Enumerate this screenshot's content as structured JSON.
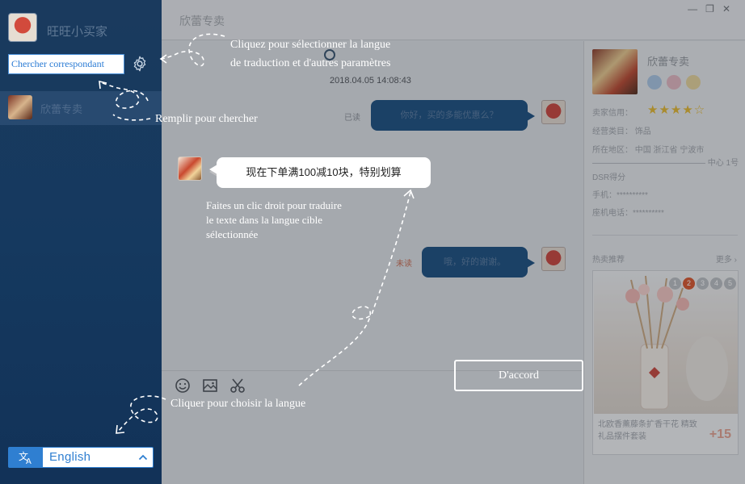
{
  "sidebar": {
    "username": "旺旺小买家",
    "search": {
      "value": "Chercher correspondant"
    },
    "contacts": [
      {
        "name": "欣蕾专卖"
      }
    ],
    "language": {
      "icon": "translate-icon",
      "label": "English"
    }
  },
  "chat": {
    "title": "欣蕾专卖",
    "timestamp": "2018.04.05 14:08:43",
    "messages": [
      {
        "side": "right",
        "text": "你好，买的多能优惠么？",
        "status": "已读"
      },
      {
        "side": "left",
        "text": "现在下单满100减10块，特别划算"
      },
      {
        "side": "right",
        "text": "哦，好的谢谢。",
        "status": "未读"
      }
    ],
    "toolbar": {
      "icons": [
        "emoji-icon",
        "image-icon",
        "scissors-icon"
      ]
    },
    "ok_button": "D'accord"
  },
  "info_panel": {
    "shop_name": "欣蕾专卖",
    "rows": {
      "rating": "卖家信用：",
      "brand": "经营类目：  饰品",
      "location": "所在地区：  中国 浙江省 宁波市",
      "location_2": "—————————————— 中心 1号",
      "dsr": "DSR得分",
      "phone": "手机：**********",
      "tel": "座机电话：**********"
    },
    "rec_title": "热卖推荐",
    "rec_more": "更多 ›",
    "rec_pages": [
      "1",
      "2",
      "3",
      "4",
      "5"
    ],
    "rec_desc": "北欧香薰藤条扩香干花 精致礼品摆件套装",
    "rec_price": "+15"
  },
  "overlay": {
    "hint_settings_1": "Cliquez pour sélectionner la langue",
    "hint_settings_2": "de traduction et d'autres paramètres",
    "hint_search": "Remplir pour chercher",
    "hint_translate_1": "Faites un clic droit pour traduire",
    "hint_translate_2": "le texte dans la langue cible",
    "hint_translate_3": "sélectionnée",
    "hint_language": "Cliquer pour choisir la langue"
  },
  "colors": {
    "accent": "#2f7fd1",
    "sidebar": "#163a60",
    "bubble_blue": "#174c7e",
    "star": "#e2b62e"
  }
}
